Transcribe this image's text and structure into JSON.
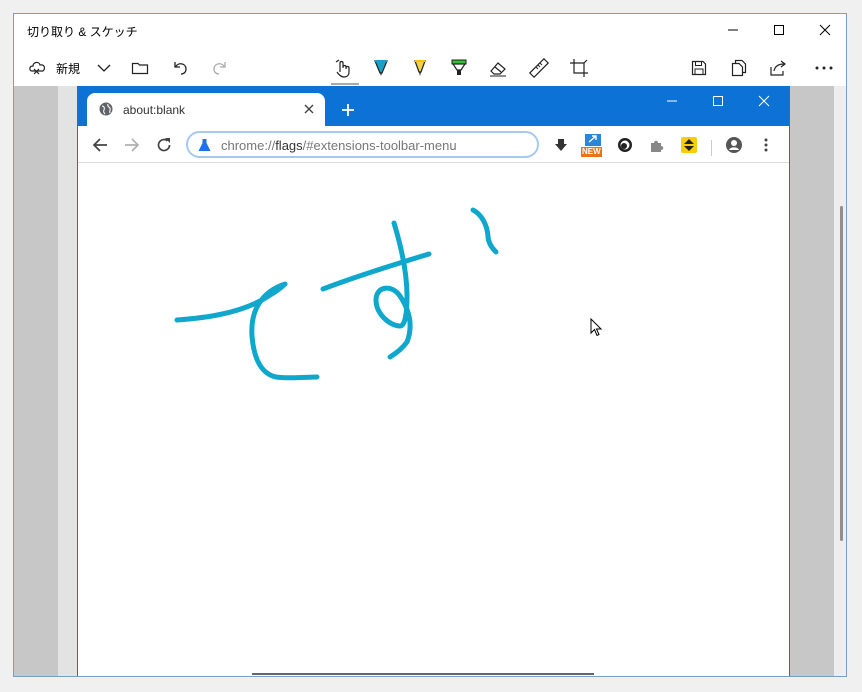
{
  "app": {
    "title": "切り取り & スケッチ"
  },
  "toolbar": {
    "new_label": "新規"
  },
  "browser": {
    "tab_title": "about:blank",
    "address_scheme": "chrome://",
    "address_host": "flags",
    "address_path": "/#extensions-toolbar-menu",
    "new_badge": "NEW"
  },
  "ink": {
    "color": "#0fa8cc",
    "text": "てす"
  },
  "colors": {
    "chrome_accent": "#0d72d5",
    "canvas_gray": "#c7c7c7"
  }
}
